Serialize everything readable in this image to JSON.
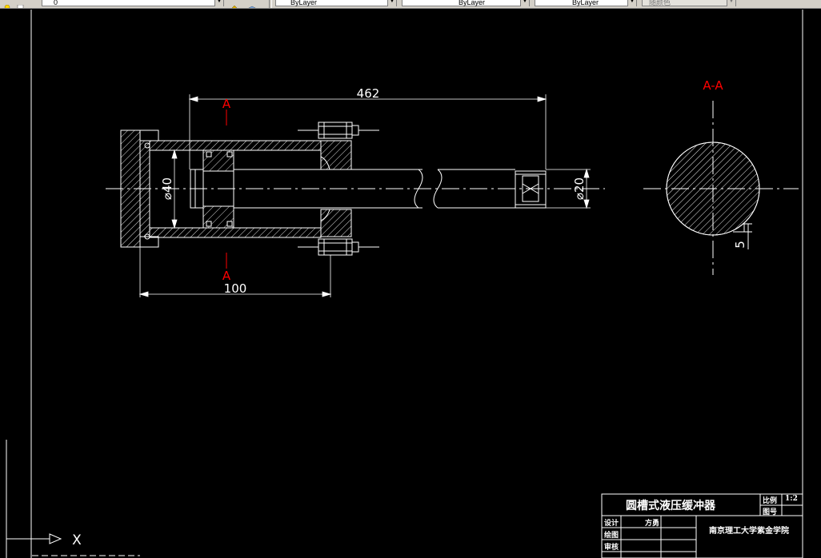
{
  "toolbar": {
    "layer_value": "0",
    "color_value": "ByLayer",
    "linetype_value": "ByLayer",
    "lineweight_value": "ByLayer",
    "plotstyle_value": "随颜色"
  },
  "drawing": {
    "dim_length": "462",
    "dim_base": "100",
    "dim_bore": "⌀40",
    "dim_rod": "⌀20",
    "dim_groove": "5",
    "section_mark_top": "A",
    "section_mark_bottom": "A",
    "section_title": "A-A",
    "ucs_x_label": "X"
  },
  "title_block": {
    "name": "圆槽式液压缓冲器",
    "scale_label": "比例",
    "scale_value": "1:2",
    "drawing_no_label": "图号",
    "design_label": "设计",
    "designer": "方勇",
    "draw_label": "绘图",
    "review_label": "审核",
    "school": "南京理工大学紫金学院"
  },
  "colors": {
    "background": "#000000",
    "line": "#ffffff",
    "section_mark": "#ff0000"
  }
}
